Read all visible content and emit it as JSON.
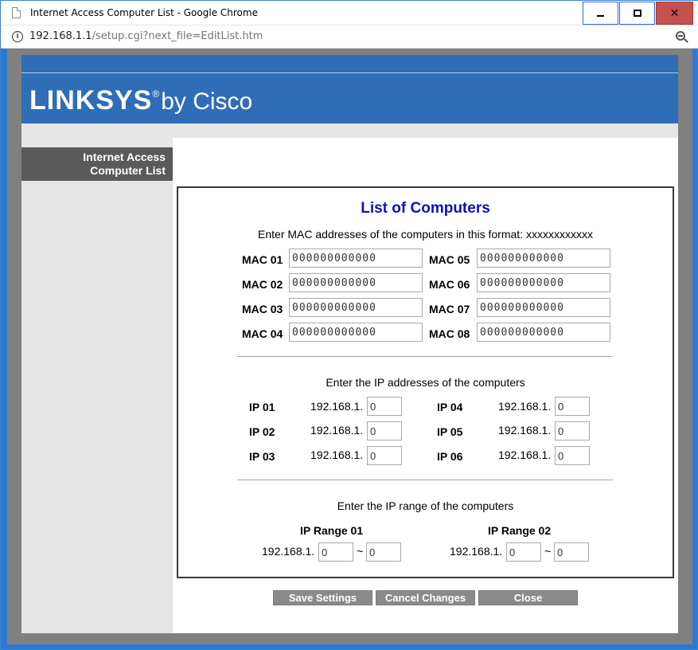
{
  "window": {
    "title": "Internet Access Computer List - Google Chrome",
    "url_host": "192.168.1.1",
    "url_path": "/setup.cgi?next_file=EditList.htm"
  },
  "logo": {
    "brand": "LINKSYS",
    "reg": "®",
    "by": "by Cisco"
  },
  "sidebar": {
    "line1": "Internet Access",
    "line2": "Computer List"
  },
  "main": {
    "heading": "List of Computers",
    "mac_instructions": "Enter MAC addresses of the computers in this format: xxxxxxxxxxxx",
    "mac": [
      {
        "label": "MAC 01",
        "value": "000000000000"
      },
      {
        "label": "MAC 02",
        "value": "000000000000"
      },
      {
        "label": "MAC 03",
        "value": "000000000000"
      },
      {
        "label": "MAC 04",
        "value": "000000000000"
      },
      {
        "label": "MAC 05",
        "value": "000000000000"
      },
      {
        "label": "MAC 06",
        "value": "000000000000"
      },
      {
        "label": "MAC 07",
        "value": "000000000000"
      },
      {
        "label": "MAC 08",
        "value": "000000000000"
      }
    ],
    "ip_instructions": "Enter the IP addresses of the computers",
    "ip_prefix": "192.168.1.",
    "ip": [
      {
        "label": "IP 01",
        "value": "0"
      },
      {
        "label": "IP 02",
        "value": "0"
      },
      {
        "label": "IP 03",
        "value": "0"
      },
      {
        "label": "IP 04",
        "value": "0"
      },
      {
        "label": "IP 05",
        "value": "0"
      },
      {
        "label": "IP 06",
        "value": "0"
      }
    ],
    "range_instructions": "Enter the IP range of the computers",
    "range": [
      {
        "label": "IP Range 01",
        "start": "0",
        "end": "0"
      },
      {
        "label": "IP Range 02",
        "start": "0",
        "end": "0"
      }
    ],
    "range_separator": "~"
  },
  "buttons": {
    "save": "Save Settings",
    "cancel": "Cancel Changes",
    "close": "Close"
  }
}
